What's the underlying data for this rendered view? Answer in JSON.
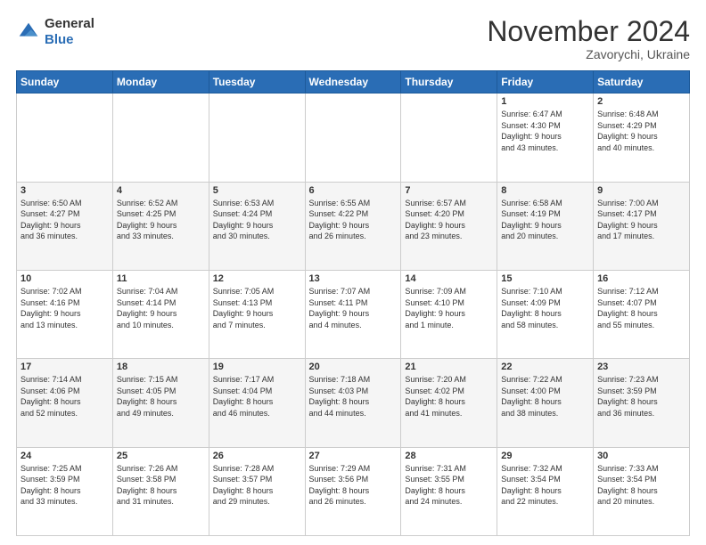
{
  "header": {
    "logo_general": "General",
    "logo_blue": "Blue",
    "month_title": "November 2024",
    "location": "Zavorychi, Ukraine"
  },
  "days_of_week": [
    "Sunday",
    "Monday",
    "Tuesday",
    "Wednesday",
    "Thursday",
    "Friday",
    "Saturday"
  ],
  "weeks": [
    [
      {
        "day": "",
        "info": ""
      },
      {
        "day": "",
        "info": ""
      },
      {
        "day": "",
        "info": ""
      },
      {
        "day": "",
        "info": ""
      },
      {
        "day": "",
        "info": ""
      },
      {
        "day": "1",
        "info": "Sunrise: 6:47 AM\nSunset: 4:30 PM\nDaylight: 9 hours\nand 43 minutes."
      },
      {
        "day": "2",
        "info": "Sunrise: 6:48 AM\nSunset: 4:29 PM\nDaylight: 9 hours\nand 40 minutes."
      }
    ],
    [
      {
        "day": "3",
        "info": "Sunrise: 6:50 AM\nSunset: 4:27 PM\nDaylight: 9 hours\nand 36 minutes."
      },
      {
        "day": "4",
        "info": "Sunrise: 6:52 AM\nSunset: 4:25 PM\nDaylight: 9 hours\nand 33 minutes."
      },
      {
        "day": "5",
        "info": "Sunrise: 6:53 AM\nSunset: 4:24 PM\nDaylight: 9 hours\nand 30 minutes."
      },
      {
        "day": "6",
        "info": "Sunrise: 6:55 AM\nSunset: 4:22 PM\nDaylight: 9 hours\nand 26 minutes."
      },
      {
        "day": "7",
        "info": "Sunrise: 6:57 AM\nSunset: 4:20 PM\nDaylight: 9 hours\nand 23 minutes."
      },
      {
        "day": "8",
        "info": "Sunrise: 6:58 AM\nSunset: 4:19 PM\nDaylight: 9 hours\nand 20 minutes."
      },
      {
        "day": "9",
        "info": "Sunrise: 7:00 AM\nSunset: 4:17 PM\nDaylight: 9 hours\nand 17 minutes."
      }
    ],
    [
      {
        "day": "10",
        "info": "Sunrise: 7:02 AM\nSunset: 4:16 PM\nDaylight: 9 hours\nand 13 minutes."
      },
      {
        "day": "11",
        "info": "Sunrise: 7:04 AM\nSunset: 4:14 PM\nDaylight: 9 hours\nand 10 minutes."
      },
      {
        "day": "12",
        "info": "Sunrise: 7:05 AM\nSunset: 4:13 PM\nDaylight: 9 hours\nand 7 minutes."
      },
      {
        "day": "13",
        "info": "Sunrise: 7:07 AM\nSunset: 4:11 PM\nDaylight: 9 hours\nand 4 minutes."
      },
      {
        "day": "14",
        "info": "Sunrise: 7:09 AM\nSunset: 4:10 PM\nDaylight: 9 hours\nand 1 minute."
      },
      {
        "day": "15",
        "info": "Sunrise: 7:10 AM\nSunset: 4:09 PM\nDaylight: 8 hours\nand 58 minutes."
      },
      {
        "day": "16",
        "info": "Sunrise: 7:12 AM\nSunset: 4:07 PM\nDaylight: 8 hours\nand 55 minutes."
      }
    ],
    [
      {
        "day": "17",
        "info": "Sunrise: 7:14 AM\nSunset: 4:06 PM\nDaylight: 8 hours\nand 52 minutes."
      },
      {
        "day": "18",
        "info": "Sunrise: 7:15 AM\nSunset: 4:05 PM\nDaylight: 8 hours\nand 49 minutes."
      },
      {
        "day": "19",
        "info": "Sunrise: 7:17 AM\nSunset: 4:04 PM\nDaylight: 8 hours\nand 46 minutes."
      },
      {
        "day": "20",
        "info": "Sunrise: 7:18 AM\nSunset: 4:03 PM\nDaylight: 8 hours\nand 44 minutes."
      },
      {
        "day": "21",
        "info": "Sunrise: 7:20 AM\nSunset: 4:02 PM\nDaylight: 8 hours\nand 41 minutes."
      },
      {
        "day": "22",
        "info": "Sunrise: 7:22 AM\nSunset: 4:00 PM\nDaylight: 8 hours\nand 38 minutes."
      },
      {
        "day": "23",
        "info": "Sunrise: 7:23 AM\nSunset: 3:59 PM\nDaylight: 8 hours\nand 36 minutes."
      }
    ],
    [
      {
        "day": "24",
        "info": "Sunrise: 7:25 AM\nSunset: 3:59 PM\nDaylight: 8 hours\nand 33 minutes."
      },
      {
        "day": "25",
        "info": "Sunrise: 7:26 AM\nSunset: 3:58 PM\nDaylight: 8 hours\nand 31 minutes."
      },
      {
        "day": "26",
        "info": "Sunrise: 7:28 AM\nSunset: 3:57 PM\nDaylight: 8 hours\nand 29 minutes."
      },
      {
        "day": "27",
        "info": "Sunrise: 7:29 AM\nSunset: 3:56 PM\nDaylight: 8 hours\nand 26 minutes."
      },
      {
        "day": "28",
        "info": "Sunrise: 7:31 AM\nSunset: 3:55 PM\nDaylight: 8 hours\nand 24 minutes."
      },
      {
        "day": "29",
        "info": "Sunrise: 7:32 AM\nSunset: 3:54 PM\nDaylight: 8 hours\nand 22 minutes."
      },
      {
        "day": "30",
        "info": "Sunrise: 7:33 AM\nSunset: 3:54 PM\nDaylight: 8 hours\nand 20 minutes."
      }
    ]
  ]
}
